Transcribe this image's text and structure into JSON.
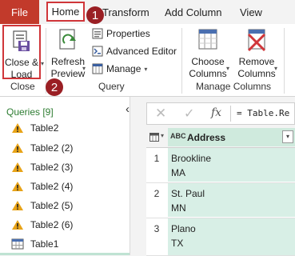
{
  "tabs": [
    "File",
    "Home",
    "Transform",
    "Add Column",
    "View"
  ],
  "ribbon": {
    "close_group": "Close",
    "close_load": [
      "Close &",
      "Load"
    ],
    "query_group": "Query",
    "refresh_preview": [
      "Refresh",
      "Preview"
    ],
    "properties": "Properties",
    "advanced_editor": "Advanced Editor",
    "manage": "Manage",
    "manage_columns_group": "Manage Columns",
    "choose_columns": [
      "Choose",
      "Columns"
    ],
    "remove_columns": [
      "Remove",
      "Columns"
    ],
    "step_badges": [
      "1",
      "2"
    ]
  },
  "queries": {
    "title": "Queries [9]",
    "items": [
      "Table2",
      "Table2 (2)",
      "Table2 (3)",
      "Table2 (4)",
      "Table2 (5)",
      "Table2 (6)",
      "Table1"
    ]
  },
  "formula": {
    "fx": "fx",
    "text": "= Table.Re"
  },
  "grid": {
    "column_type": "ABC",
    "column_header": "Address",
    "rows": [
      {
        "num": "1",
        "line1": "Brookline",
        "line2": "MA"
      },
      {
        "num": "2",
        "line1": "St. Paul",
        "line2": "MN"
      },
      {
        "num": "3",
        "line1": "Plano",
        "line2": "TX"
      }
    ]
  },
  "colors": {
    "accent": "#c23a2b",
    "highlight": "#d0363a",
    "badge": "#9a1f24",
    "column": "#d8efe6",
    "queries_title": "#2e7d32"
  }
}
